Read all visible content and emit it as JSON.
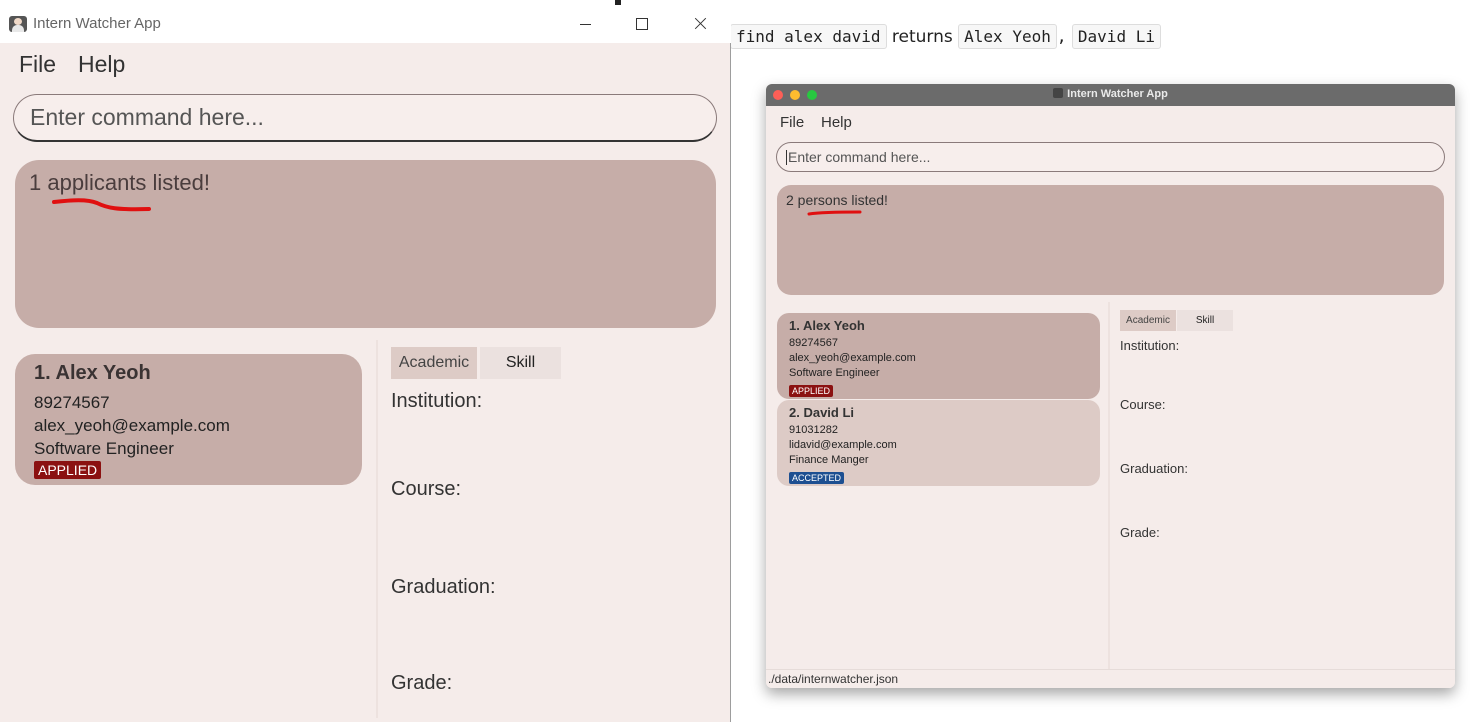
{
  "caption": {
    "cmd": "find alex david",
    "returns": "returns",
    "result1": "Alex Yeoh",
    "sep": ",",
    "result2": "David Li"
  },
  "left_window": {
    "title": "Intern Watcher App",
    "menu": [
      "File",
      "Help"
    ],
    "command_placeholder": "Enter command here...",
    "result_text": "1 applicants listed!",
    "cards": [
      {
        "index_name": "1.  Alex Yeoh",
        "phone": "89274567",
        "email": "alex_yeoh@example.com",
        "role": "Software Engineer",
        "status": "APPLIED",
        "status_color": "#8b1111"
      }
    ],
    "tabs": [
      "Academic",
      "Skill"
    ],
    "detail_labels": [
      "Institution:",
      "Course:",
      "Graduation:",
      "Grade:"
    ]
  },
  "right_window": {
    "title": "Intern Watcher App",
    "menu": [
      "File",
      "Help"
    ],
    "command_placeholder": "Enter command here...",
    "result_text": "2 persons listed!",
    "cards": [
      {
        "index_name": "1.  Alex Yeoh",
        "phone": "89274567",
        "email": "alex_yeoh@example.com",
        "role": "Software Engineer",
        "status": "APPLIED",
        "status_color": "#8b1111"
      },
      {
        "index_name": "2.  David Li",
        "phone": "91031282",
        "email": "lidavid@example.com",
        "role": "Finance Manger",
        "status": "ACCEPTED",
        "status_color": "#1d4f91"
      }
    ],
    "tabs": [
      "Academic",
      "Skill"
    ],
    "detail_labels": [
      "Institution:",
      "Course:",
      "Graduation:",
      "Grade:"
    ],
    "status_bar": "./data/internwatcher.json"
  },
  "colors": {
    "window_bg": "#f5ecea",
    "card_bg": "#c6ada8",
    "card_bg_light": "#ddcbc6",
    "annotation_red": "#e01010"
  }
}
